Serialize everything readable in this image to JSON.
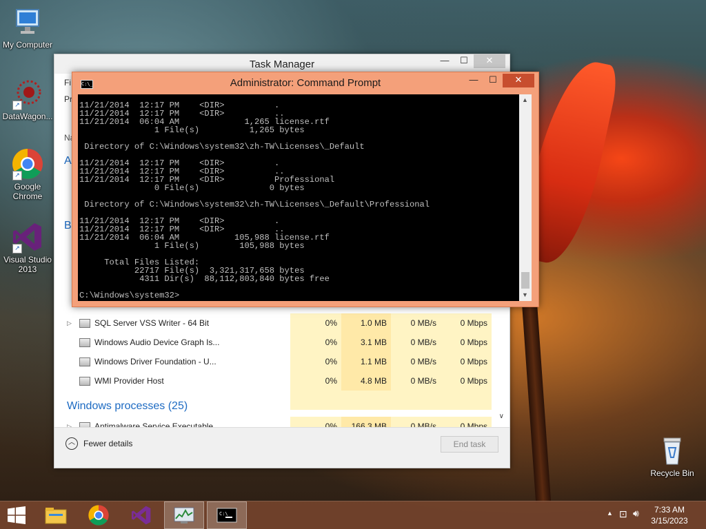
{
  "desktop": {
    "icons": [
      {
        "label": "My Computer",
        "icon": "computer-icon"
      },
      {
        "label": "DataWagon...",
        "icon": "datawagon-icon"
      },
      {
        "label": "Google Chrome",
        "icon": "chrome-icon"
      },
      {
        "label": "Visual Studio 2013",
        "icon": "visual-studio-icon"
      },
      {
        "label": "Recycle Bin",
        "icon": "recycle-bin-icon"
      }
    ]
  },
  "task_manager": {
    "title": "Task Manager",
    "stub_labels": [
      "Fi",
      "Pr",
      "Na",
      "A",
      "B"
    ],
    "rows": [
      {
        "name": "SQL Server VSS Writer - 64 Bit",
        "cpu": "0%",
        "memory": "1.0 MB",
        "disk": "0 MB/s",
        "network": "0 Mbps",
        "expandable": true
      },
      {
        "name": "Windows Audio Device Graph Is...",
        "cpu": "0%",
        "memory": "3.1 MB",
        "disk": "0 MB/s",
        "network": "0 Mbps",
        "expandable": false
      },
      {
        "name": "Windows Driver Foundation - U...",
        "cpu": "0%",
        "memory": "1.1 MB",
        "disk": "0 MB/s",
        "network": "0 Mbps",
        "expandable": false
      },
      {
        "name": "WMI Provider Host",
        "cpu": "0%",
        "memory": "4.8 MB",
        "disk": "0 MB/s",
        "network": "0 Mbps",
        "expandable": false
      }
    ],
    "group_label": "Windows processes (25)",
    "partial_row": {
      "name": "Antimalware Service Executable",
      "cpu": "0%",
      "memory": "166.3 MB",
      "disk": "0 MB/s",
      "network": "0 Mbps"
    },
    "fewer_details": "Fewer details",
    "end_task": "End task"
  },
  "cmd": {
    "title": "Administrator:  Command Prompt",
    "icon_text": "C:\\_",
    "output": "11/21/2014  12:17 PM    <DIR>          .\n11/21/2014  12:17 PM    <DIR>          ..\n11/21/2014  06:04 AM             1,265 license.rtf\n               1 File(s)          1,265 bytes\n\n Directory of C:\\Windows\\system32\\zh-TW\\Licenses\\_Default\n\n11/21/2014  12:17 PM    <DIR>          .\n11/21/2014  12:17 PM    <DIR>          ..\n11/21/2014  12:17 PM    <DIR>          Professional\n               0 File(s)              0 bytes\n\n Directory of C:\\Windows\\system32\\zh-TW\\Licenses\\_Default\\Professional\n\n11/21/2014  12:17 PM    <DIR>          .\n11/21/2014  12:17 PM    <DIR>          ..\n11/21/2014  06:04 AM           105,988 license.rtf\n               1 File(s)        105,988 bytes\n\n     Total Files Listed:\n           22717 File(s)  3,321,317,658 bytes\n            4311 Dir(s)  88,112,803,840 bytes free\n\nC:\\Windows\\system32>"
  },
  "taskbar": {
    "clock_time": "7:33 AM",
    "clock_date": "3/15/2023"
  }
}
